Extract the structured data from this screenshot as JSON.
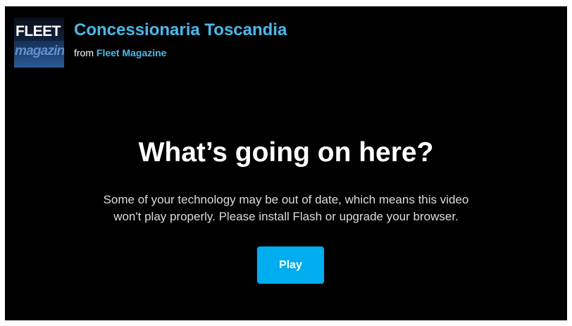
{
  "header": {
    "logo_line1": "FLEET",
    "logo_line2": "magazine",
    "title": "Concessionaria Toscandia",
    "byline_prefix": "from",
    "byline_owner": "Fleet Magazine"
  },
  "notice": {
    "heading": "What’s going on here?",
    "message_line1": "Some of your technology may be out of date, which means this video",
    "message_line2": "won't play properly. Please install Flash or upgrade your browser.",
    "play_label": "Play"
  },
  "colors": {
    "background": "#000000",
    "accent": "#44bbee",
    "button": "#00adef"
  }
}
